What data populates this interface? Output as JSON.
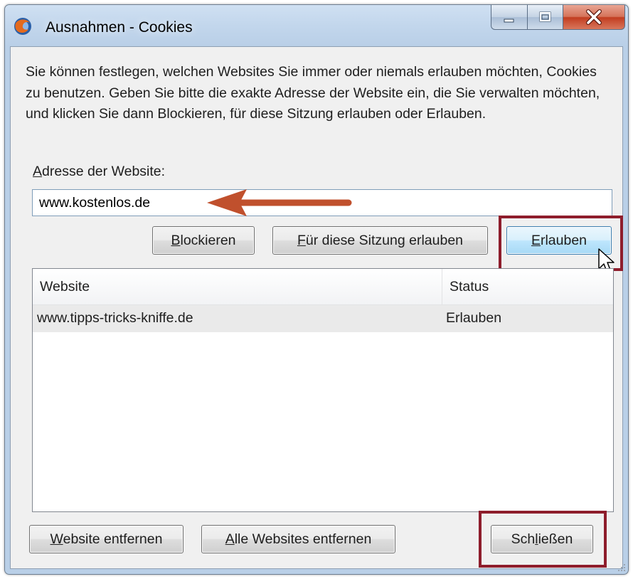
{
  "window": {
    "title": "Ausnahmen - Cookies",
    "icon": "firefox-icon",
    "controls": [
      "minimize-icon",
      "maximize-icon",
      "close-icon"
    ]
  },
  "intro_text": "Sie können festlegen, welchen Websites Sie immer oder niemals erlauben möchten, Cookies zu benutzen. Geben Sie bitte die exakte Adresse der Website ein, die Sie verwalten möchten, und klicken Sie dann Blockieren, für diese Sitzung erlauben oder Erlauben.",
  "address": {
    "label_prefix": "A",
    "label_rest": "dresse der Website:",
    "value": "www.kostenlos.de"
  },
  "buttons": {
    "block": {
      "prefix": "",
      "key": "B",
      "rest": "lockieren"
    },
    "session": {
      "prefix": "",
      "key": "F",
      "rest": "ür diese Sitzung erlauben"
    },
    "allow": {
      "prefix": "",
      "key": "E",
      "rest": "rlauben"
    },
    "remove": {
      "prefix": "",
      "key": "W",
      "rest": "ebsite entfernen"
    },
    "remove_all": {
      "prefix": "",
      "key": "A",
      "rest": "lle Websites entfernen"
    },
    "close": {
      "prefix": "Sch",
      "key": "l",
      "rest": "ießen"
    }
  },
  "table": {
    "columns": [
      "Website",
      "Status"
    ],
    "rows": [
      {
        "website": "www.tipps-tricks-kniffe.de",
        "status": "Erlauben"
      }
    ]
  },
  "colors": {
    "highlight_box": "#8e1d2c",
    "annotation_arrow": "#c0502d",
    "hot_button": "#bee6fd"
  }
}
